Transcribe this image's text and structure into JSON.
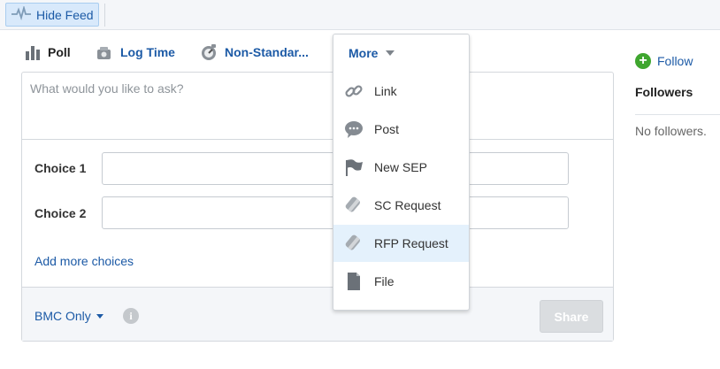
{
  "topbar": {
    "hide_feed_label": "Hide Feed",
    "hide_feed_icon": "pulse-icon"
  },
  "tabs": [
    {
      "label": "Poll",
      "icon": "bar-chart-icon"
    },
    {
      "label": "Log Time",
      "icon": "clock-icon"
    },
    {
      "label": "Non-Standar...",
      "icon": "dial-icon"
    }
  ],
  "composer": {
    "question_placeholder": "What would you like to ask?",
    "choices": [
      {
        "label": "Choice 1",
        "value": ""
      },
      {
        "label": "Choice 2",
        "value": ""
      }
    ],
    "add_more_label": "Add more choices",
    "visibility_label": "BMC Only",
    "share_label": "Share"
  },
  "more_menu": {
    "label": "More",
    "items": [
      {
        "label": "Link",
        "icon": "link-icon"
      },
      {
        "label": "Post",
        "icon": "speech-bubble-icon"
      },
      {
        "label": "New SEP",
        "icon": "flag-icon"
      },
      {
        "label": "SC Request",
        "icon": "eraser-icon"
      },
      {
        "label": "RFP Request",
        "icon": "eraser-icon",
        "highlighted": true
      },
      {
        "label": "File",
        "icon": "file-icon"
      }
    ]
  },
  "sidebar": {
    "follow_label": "Follow",
    "followers_title": "Followers",
    "no_followers_text": "No followers."
  },
  "colors": {
    "link": "#1c5aa6",
    "follow_green": "#3fa62f",
    "menu_highlight": "#e4f1fc"
  }
}
